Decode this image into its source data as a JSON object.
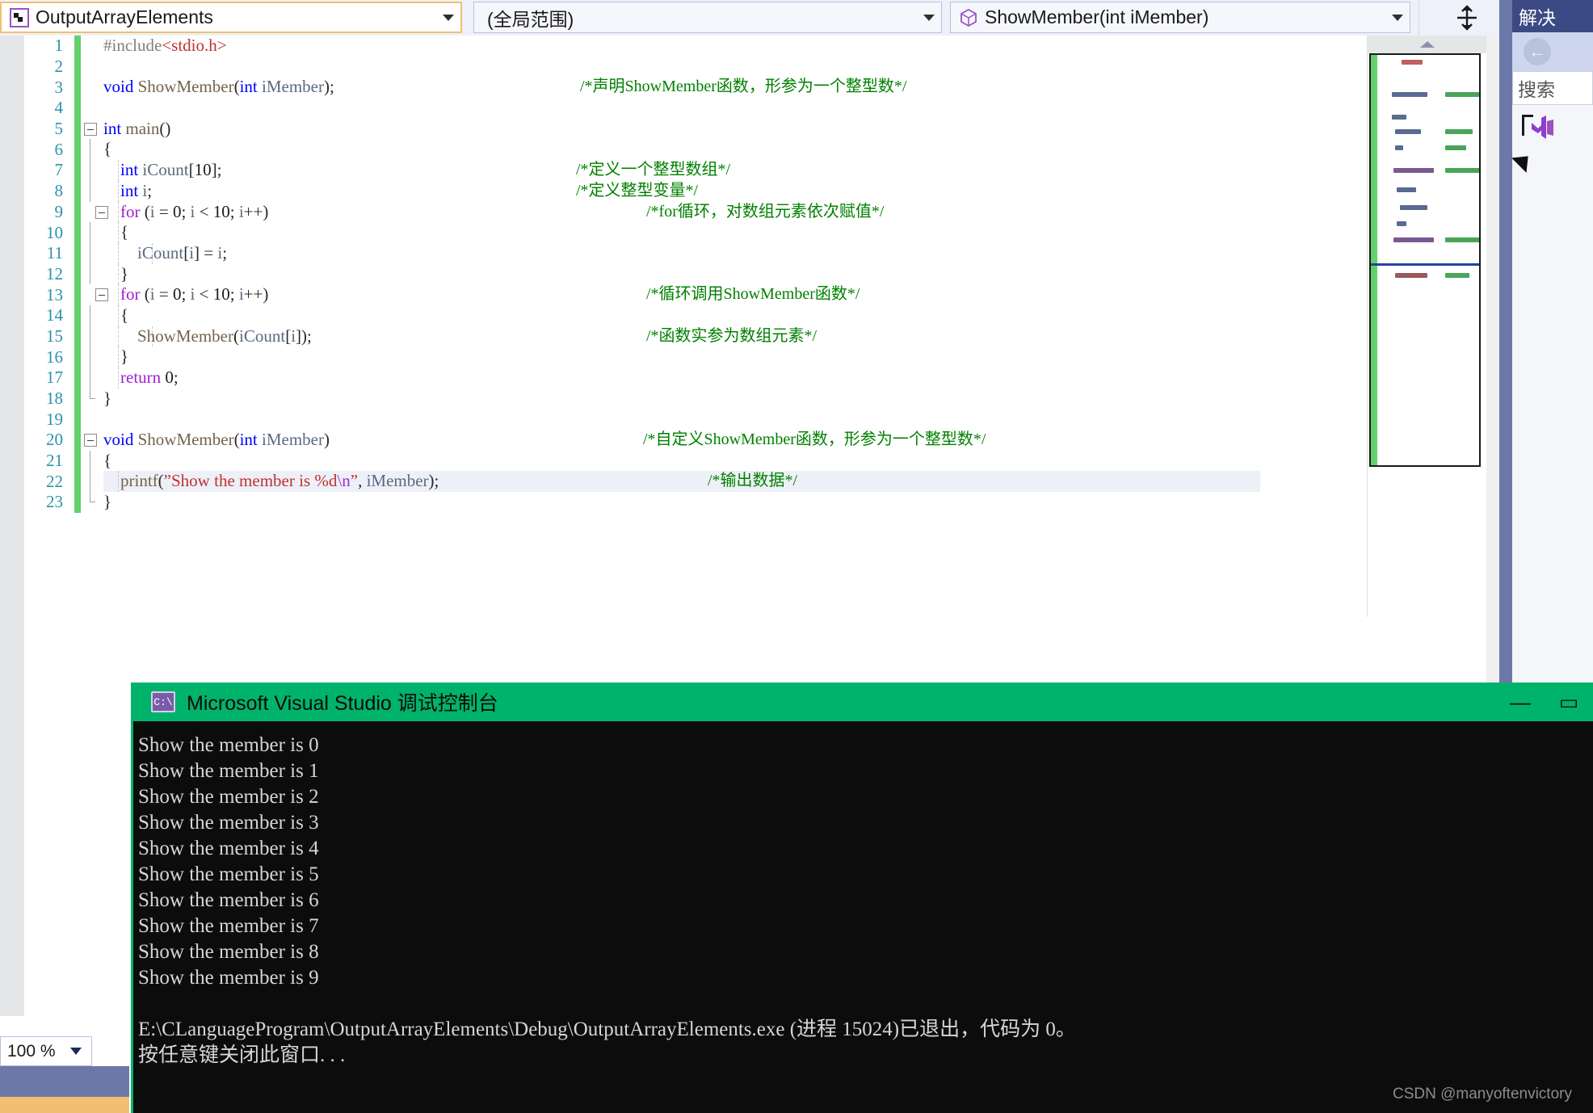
{
  "navbar": {
    "project_combo": {
      "value": "OutputArrayElements",
      "icon": "project-icon"
    },
    "scope_combo": {
      "value": "(全局范围)",
      "icon": "chevron-down-icon"
    },
    "function_combo": {
      "value": "ShowMember(int iMember)",
      "icon": "method-cube-icon"
    },
    "split_button_label": "split-view-icon"
  },
  "editor": {
    "lines": [
      {
        "no": "1",
        "indent": 0,
        "fold": "",
        "text": "#include<stdio.h>",
        "comment": ""
      },
      {
        "no": "2",
        "indent": 0,
        "fold": "",
        "text": "",
        "comment": ""
      },
      {
        "no": "3",
        "indent": 0,
        "fold": "",
        "text": "void ShowMember(int iMember);",
        "comment": "/*声明ShowMember函数，形参为一个整型数*/"
      },
      {
        "no": "4",
        "indent": 0,
        "fold": "",
        "text": "",
        "comment": ""
      },
      {
        "no": "5",
        "indent": 0,
        "fold": "box",
        "text": "int main()",
        "comment": ""
      },
      {
        "no": "6",
        "indent": 0,
        "fold": "line",
        "text": "{",
        "comment": ""
      },
      {
        "no": "7",
        "indent": 1,
        "fold": "line",
        "text": "    int iCount[10];",
        "comment": "/*定义一个整型数组*/"
      },
      {
        "no": "8",
        "indent": 1,
        "fold": "line",
        "text": "    int i;",
        "comment": "/*定义整型变量*/"
      },
      {
        "no": "9",
        "indent": 1,
        "fold": "box2",
        "text": "    for (i = 0; i < 10; i++)",
        "comment": "/*for循环，对数组元素依次赋值*/"
      },
      {
        "no": "10",
        "indent": 1,
        "fold": "line",
        "text": "    {",
        "comment": ""
      },
      {
        "no": "11",
        "indent": 2,
        "fold": "line",
        "text": "        iCount[i] = i;",
        "comment": ""
      },
      {
        "no": "12",
        "indent": 1,
        "fold": "line",
        "text": "    }",
        "comment": ""
      },
      {
        "no": "13",
        "indent": 1,
        "fold": "box2",
        "text": "    for (i = 0; i < 10; i++)",
        "comment": "/*循环调用ShowMember函数*/"
      },
      {
        "no": "14",
        "indent": 1,
        "fold": "line",
        "text": "    {",
        "comment": ""
      },
      {
        "no": "15",
        "indent": 2,
        "fold": "line",
        "text": "        ShowMember(iCount[i]);",
        "comment": "/*函数实参为数组元素*/"
      },
      {
        "no": "16",
        "indent": 1,
        "fold": "line",
        "text": "    }",
        "comment": ""
      },
      {
        "no": "17",
        "indent": 1,
        "fold": "line",
        "text": "    return 0;",
        "comment": ""
      },
      {
        "no": "18",
        "indent": 0,
        "fold": "endcap",
        "text": "}",
        "comment": ""
      },
      {
        "no": "19",
        "indent": 0,
        "fold": "",
        "text": "",
        "comment": ""
      },
      {
        "no": "20",
        "indent": 0,
        "fold": "box",
        "text": "void ShowMember(int iMember)",
        "comment": "/*自定义ShowMember函数，形参为一个整型数*/"
      },
      {
        "no": "21",
        "indent": 0,
        "fold": "line",
        "text": "{",
        "comment": ""
      },
      {
        "no": "22",
        "indent": 1,
        "fold": "line",
        "text": "    printf(\"Show the member is %d\\n\", iMember);",
        "comment": "/*输出数据*/"
      },
      {
        "no": "23",
        "indent": 0,
        "fold": "endcap",
        "text": "}",
        "comment": ""
      }
    ],
    "highlighted_line": "22"
  },
  "minimap": {
    "collapse_icon": "chevron-up-icon"
  },
  "solution_explorer": {
    "title": "解决",
    "back_icon": "back-arrow-icon",
    "search_placeholder": "搜索",
    "node_icon": "visual-studio-icon"
  },
  "status": {
    "zoom_level": "100 %",
    "zoom_caret": "chevron-down-icon"
  },
  "console": {
    "icon_label": "C:\\",
    "title": "Microsoft Visual Studio 调试控制台",
    "minimize_label": "—",
    "maximize_label": "▭",
    "output_lines": [
      "Show the member is 0",
      "Show the member is 1",
      "Show the member is 2",
      "Show the member is 3",
      "Show the member is 4",
      "Show the member is 5",
      "Show the member is 6",
      "Show the member is 7",
      "Show the member is 8",
      "Show the member is 9"
    ],
    "exit_line": "E:\\CLanguageProgram\\OutputArrayElements\\Debug\\OutputArrayElements.exe (进程 15024)已退出，代码为 0。",
    "prompt_line": "按任意键关闭此窗口. . ."
  },
  "watermark": "CSDN @manyoftenvictory",
  "colors": {
    "accent_green": "#00b36b",
    "margin_green": "#62d16b",
    "comment_green": "#008000",
    "keyword_blue": "#0000ff",
    "keyword_purple": "#a020d0",
    "string_red": "#c03030",
    "lineno_blue": "#2b91af",
    "solution_navy": "#3b4a84",
    "focus_orange": "#f0c070"
  }
}
